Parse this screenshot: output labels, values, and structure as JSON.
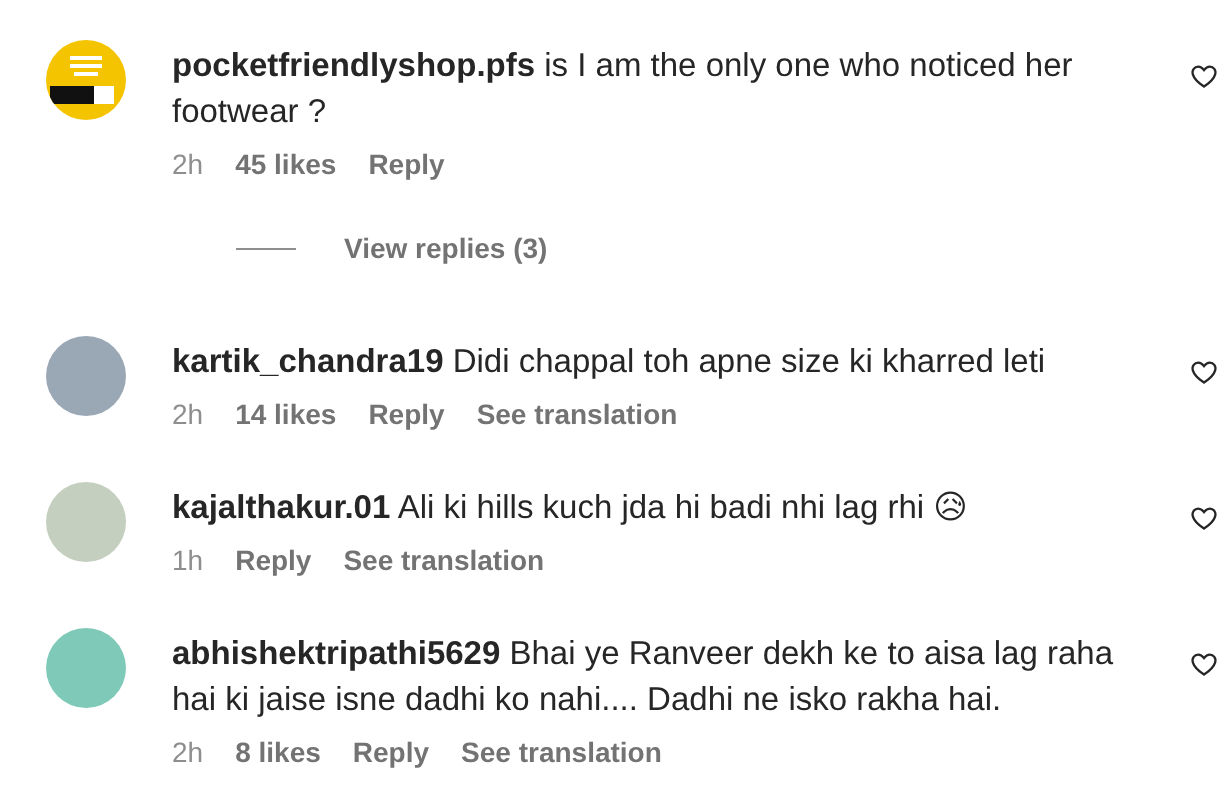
{
  "comments": [
    {
      "username": "pocketfriendlyshop.pfs",
      "kind": "logo",
      "text": "is I am the only one who noticed her footwear ?",
      "time": "2h",
      "likes": "45 likes",
      "reply": "Reply",
      "view_replies": "View replies (3)"
    },
    {
      "username": "kartik_chandra19",
      "kind": "photo",
      "text": "Didi chappal toh apne size ki kharred leti",
      "time": "2h",
      "likes": "14 likes",
      "reply": "Reply",
      "translation": "See translation"
    },
    {
      "username": "kajalthakur.01",
      "kind": "photo",
      "text": "Ali ki hills kuch jda hi badi nhi lag rhi 😥",
      "time": "1h",
      "reply": "Reply",
      "translation": "See translation"
    },
    {
      "username": "abhishektripathi5629",
      "kind": "photo",
      "text": "Bhai ye Ranveer dekh ke to aisa lag raha hai ki jaise isne dadhi ko nahi.... Dadhi ne isko rakha hai.",
      "time": "2h",
      "likes": "8 likes",
      "reply": "Reply",
      "translation": "See translation"
    }
  ]
}
